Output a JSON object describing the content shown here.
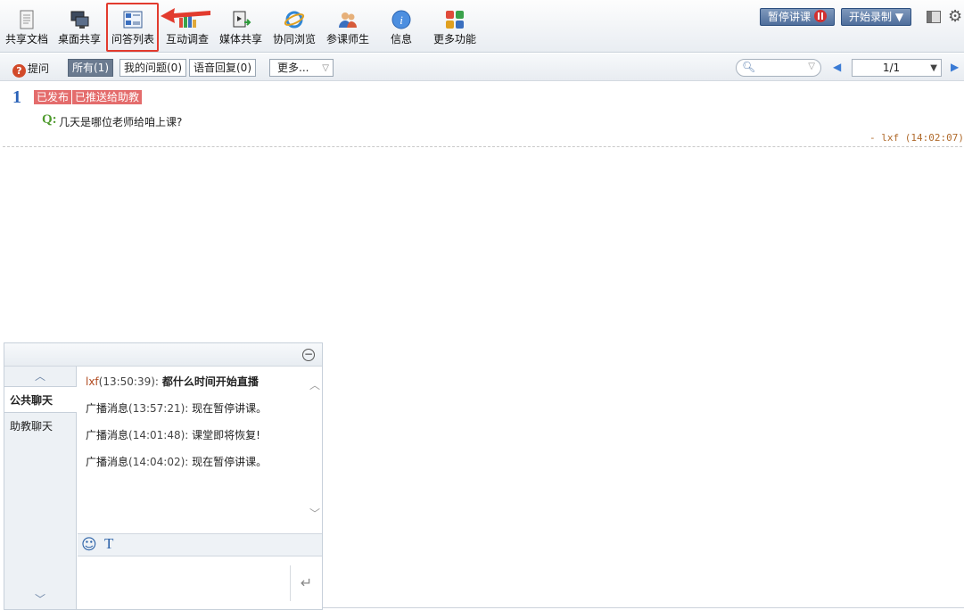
{
  "toolbar": {
    "items": [
      {
        "label": "共享文档",
        "icon": "shared-document-icon"
      },
      {
        "label": "桌面共享",
        "icon": "desktop-share-icon"
      },
      {
        "label": "问答列表",
        "icon": "qa-list-icon"
      },
      {
        "label": "互动调查",
        "icon": "survey-icon"
      },
      {
        "label": "媒体共享",
        "icon": "media-share-icon"
      },
      {
        "label": "协同浏览",
        "icon": "co-browse-icon"
      },
      {
        "label": "参课师生",
        "icon": "participants-icon"
      },
      {
        "label": "信息",
        "icon": "info-icon"
      },
      {
        "label": "更多功能",
        "icon": "more-features-icon"
      }
    ],
    "pause_label": "暂停讲课",
    "record_label": "开始录制"
  },
  "filter": {
    "ask_label": "提问",
    "tabs": [
      "所有(1)",
      "我的问题(0)",
      "语音回复(0)"
    ],
    "more_label": "更多...",
    "search_placeholder": "",
    "page": "1/1"
  },
  "question": {
    "number": "1",
    "tags": [
      "已发布",
      "已推送给助教"
    ],
    "q_label": "Q:",
    "text": "几天是哪位老师给咱上课?",
    "author": "- lxf (14:02:07)"
  },
  "chat": {
    "tabs": [
      "公共聊天",
      "助教聊天"
    ],
    "messages": [
      {
        "sender": "lxf",
        "time": "(13:50:39):",
        "text": "都什么时间开始直播"
      },
      {
        "sender": "广播消息",
        "time": "(13:57:21):",
        "text": "现在暂停讲课。"
      },
      {
        "sender": "广播消息",
        "time": "(14:01:48):",
        "text": "课堂即将恢复!"
      },
      {
        "sender": "广播消息",
        "time": "(14:04:02):",
        "text": "现在暂停讲课。"
      }
    ]
  },
  "colors": {
    "highlight": "#e23b2e",
    "accent": "#2a62b8",
    "tag": "#e46c6c"
  }
}
